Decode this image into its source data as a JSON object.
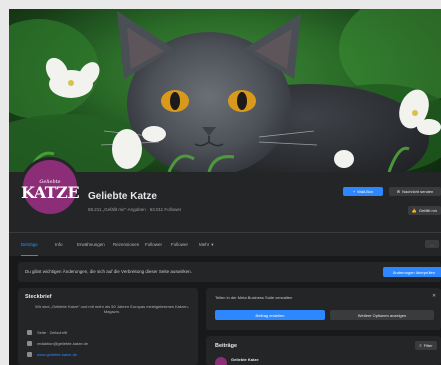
{
  "page": {
    "name": "Geliebte Katze",
    "meta": "58.211 „Gefällt mir“-Angaben · 63.011 Follower",
    "logo_small": "Geliebte",
    "logo_big": "KATZE"
  },
  "actions": {
    "primary": "Wall-Box",
    "secondary": "Nachricht senden",
    "tertiary": "Gefällt mir"
  },
  "nav": {
    "tabs": [
      "Beiträge",
      "Info",
      "Erwähnungen",
      "Rezensionen",
      "Follower",
      "Mehr"
    ],
    "more_arrow": "▾",
    "options": "…"
  },
  "banner": {
    "text": "Du gibst wichtigen Änderungen, die sich auf die Verbreitung dieser Seite auswirken.",
    "button": "Änderungen überprüfen"
  },
  "intro": {
    "title": "Steckbrief",
    "description": "Wir sind „Geliebte Katze“ und mit mehr als 50 Jahren Europas meistgelesenes Katzen-Magazin.",
    "rows": [
      {
        "icon": "page-icon",
        "text": "Seite · Zeitschrift"
      },
      {
        "icon": "mail-icon",
        "text": "redaktion@geliebte-katze.de"
      },
      {
        "icon": "link-icon",
        "text": "www.geliebte-katze.de"
      }
    ]
  },
  "composer": {
    "prompt": "Teilen in der Meta Business Suite verwalten",
    "publish": "Beitrag erstellen",
    "other": "Weitere Optionen anzeigen",
    "close": "✕"
  },
  "posts": {
    "title": "Beiträge",
    "filter": "Filter",
    "author": "Geliebte Katze",
    "sub": "Gestern"
  },
  "colors": {
    "accent": "#2d88ff",
    "brand": "#8b2e77"
  }
}
